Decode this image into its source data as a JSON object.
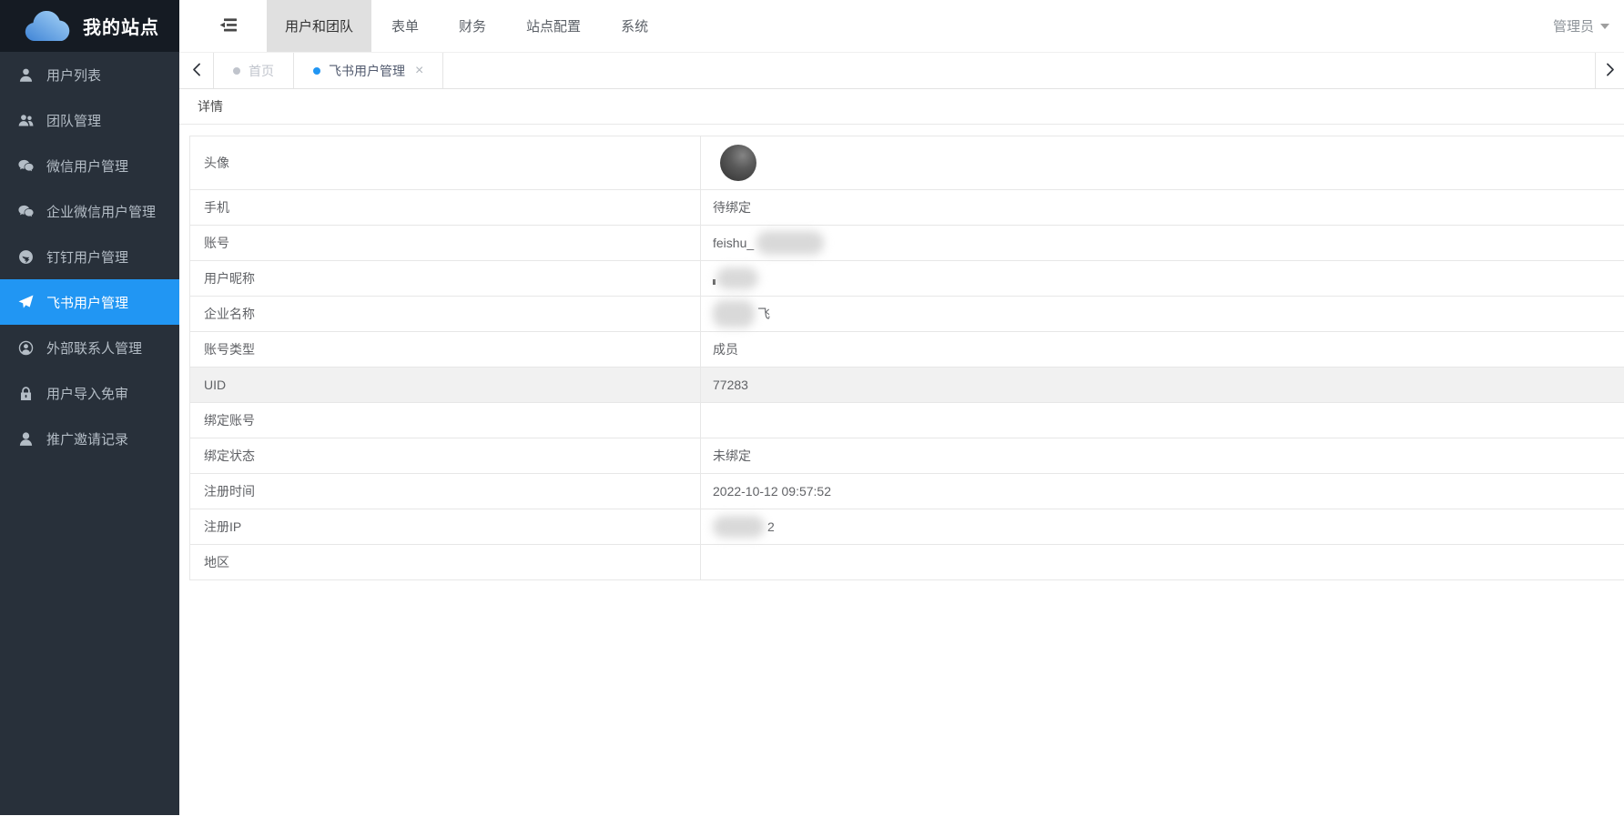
{
  "app": {
    "site_name": "我的站点"
  },
  "navbar": {
    "collapse_icon": "menu-fold-icon",
    "tabs": [
      {
        "label": "用户和团队",
        "active": true
      },
      {
        "label": "表单",
        "active": false
      },
      {
        "label": "财务",
        "active": false
      },
      {
        "label": "站点配置",
        "active": false
      },
      {
        "label": "系统",
        "active": false
      }
    ],
    "actions": [
      {
        "name": "refresh",
        "icon": "refresh-icon"
      },
      {
        "name": "trash",
        "icon": "trash-icon"
      },
      {
        "name": "fullscreen",
        "icon": "expand-icon"
      }
    ],
    "user_label": "管理员",
    "user_caret_icon": "caret-down-icon"
  },
  "tabbar": {
    "left_arrow_icon": "chevron-left-icon",
    "right_arrow_icon": "chevron-right-icon",
    "tabs": [
      {
        "label": "首页",
        "dot_color": "#c0c4cc",
        "text_color": "#c0c4cc",
        "closable": false
      },
      {
        "label": "飞书用户管理",
        "dot_color": "#2196f3",
        "text_color": "#515a6e",
        "closable": true,
        "close_glyph": "×"
      }
    ]
  },
  "sidebar": {
    "items": [
      {
        "label": "用户列表",
        "icon": "user-icon",
        "active": false
      },
      {
        "label": "团队管理",
        "icon": "users-icon",
        "active": false
      },
      {
        "label": "微信用户管理",
        "icon": "wechat-icon",
        "active": false
      },
      {
        "label": "企业微信用户管理",
        "icon": "wechat-work-icon",
        "active": false
      },
      {
        "label": "钉钉用户管理",
        "icon": "dingtalk-icon",
        "active": false
      },
      {
        "label": "飞书用户管理",
        "icon": "paper-plane-icon",
        "active": true
      },
      {
        "label": "外部联系人管理",
        "icon": "contact-circle-icon",
        "active": false
      },
      {
        "label": "用户导入免审",
        "icon": "lock-icon",
        "active": false
      },
      {
        "label": "推广邀请记录",
        "icon": "user-outline-icon",
        "active": false
      }
    ]
  },
  "page": {
    "heading": "详情"
  },
  "detail": {
    "rows": [
      {
        "label": "头像",
        "type": "avatar"
      },
      {
        "label": "手机",
        "value": "待绑定"
      },
      {
        "label": "账号",
        "prefix": "feishu_",
        "redacted_width": 74,
        "redacted_height": 26
      },
      {
        "label": "用户昵称",
        "tick": true,
        "redacted_width": 46,
        "redacted_height": 24
      },
      {
        "label": "企业名称",
        "redacted_width": 46,
        "redacted_height": 30,
        "suffix": "飞"
      },
      {
        "label": "账号类型",
        "value": "成员"
      },
      {
        "label": "UID",
        "value": "77283",
        "highlighted": true
      },
      {
        "label": "绑定账号",
        "value": ""
      },
      {
        "label": "绑定状态",
        "value": "未绑定"
      },
      {
        "label": "注册时间",
        "value": "2022-10-12 09:57:52"
      },
      {
        "label": "注册IP",
        "redacted_width": 57,
        "redacted_height": 24,
        "suffix": "2"
      },
      {
        "label": "地区",
        "value": ""
      }
    ]
  },
  "colors": {
    "accent": "#2196f3",
    "sidebar_bg": "#28303a",
    "sidebar_header_bg": "#151b23",
    "active_nav_tab_bg": "#e0e0e0",
    "highlight_row_bg": "#f1f1f1",
    "table_border": "#e7e7e7"
  }
}
